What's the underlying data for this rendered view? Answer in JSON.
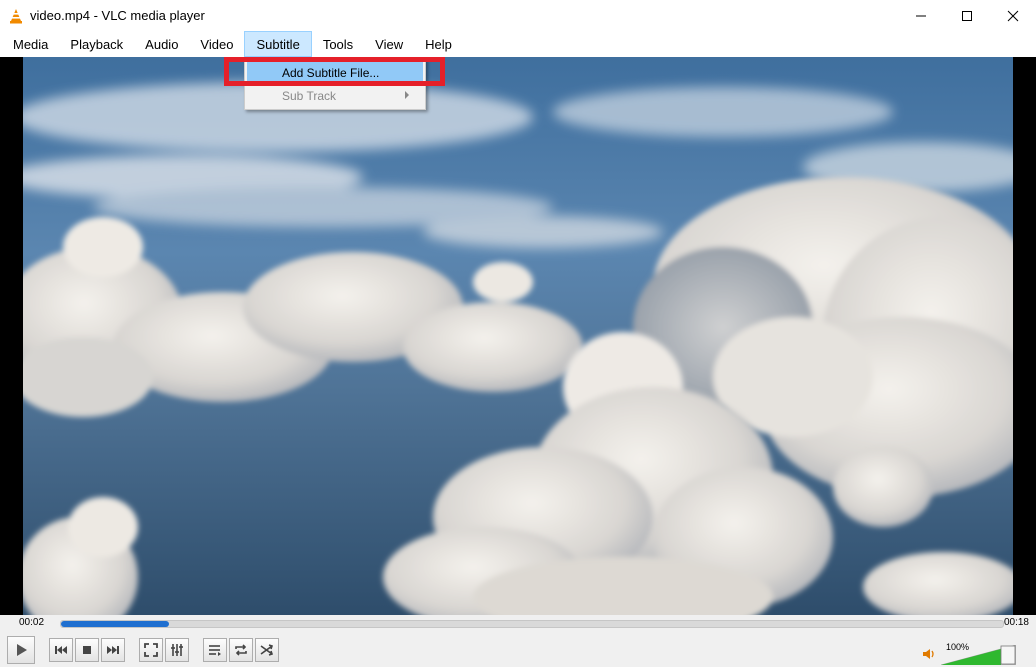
{
  "window": {
    "title": "video.mp4 - VLC media player"
  },
  "menubar": {
    "items": [
      "Media",
      "Playback",
      "Audio",
      "Video",
      "Subtitle",
      "Tools",
      "View",
      "Help"
    ],
    "active": "Subtitle"
  },
  "subtitle_menu": {
    "items": [
      {
        "label": "Add Subtitle File...",
        "state": "highlighted"
      },
      {
        "label": "Sub Track",
        "state": "disabled",
        "submenu": true
      }
    ]
  },
  "playback": {
    "current_time": "00:02",
    "total_time": "00:18",
    "progress": 0.115
  },
  "volume": {
    "label": "100%",
    "level": 1.0
  },
  "colors": {
    "accent": "#1f6fd0",
    "menu_highlight": "#91c9f7",
    "annotation": "#e5202a",
    "volume_fill": "#2fb82f"
  },
  "icons": [
    "vlc-cone-icon",
    "minimize-icon",
    "maximize-icon",
    "close-icon",
    "play-icon",
    "previous-icon",
    "stop-icon",
    "next-icon",
    "fullscreen-icon",
    "extended-settings-icon",
    "playlist-icon",
    "loop-icon",
    "shuffle-icon",
    "speaker-icon"
  ]
}
